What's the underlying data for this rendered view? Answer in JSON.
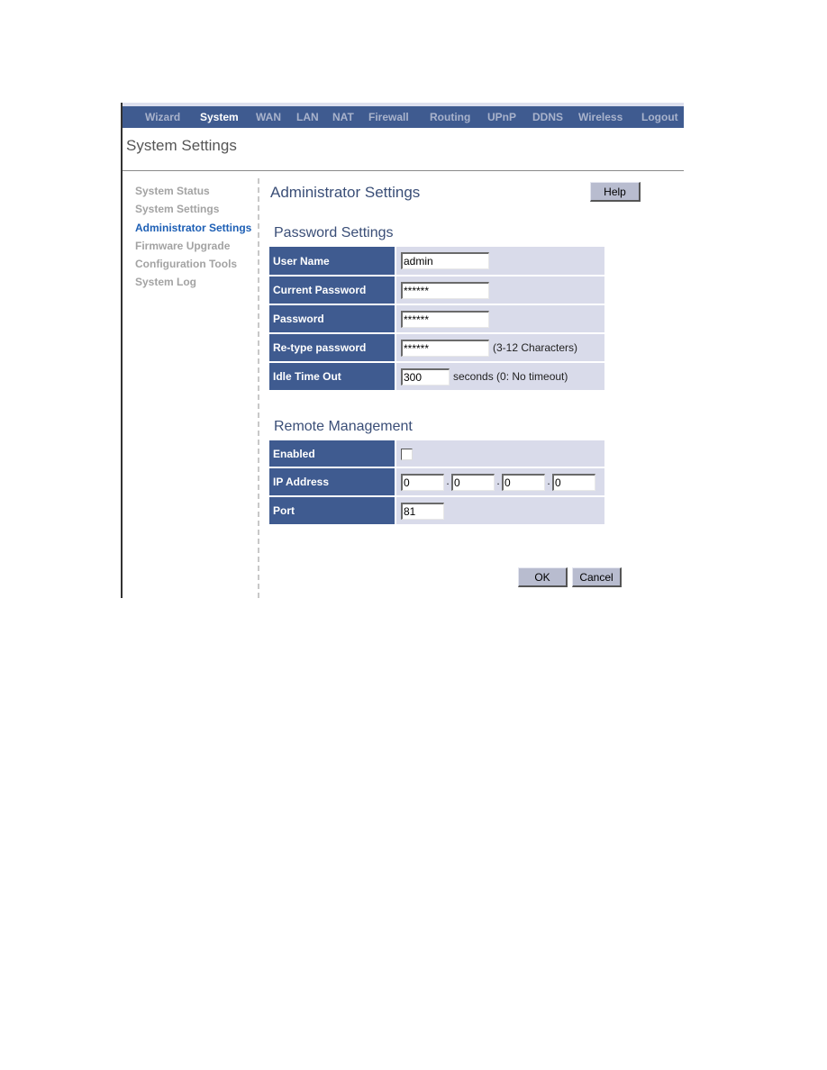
{
  "nav": {
    "items": [
      {
        "label": "Wizard",
        "active": false
      },
      {
        "label": "System",
        "active": true
      },
      {
        "label": "WAN",
        "active": false
      },
      {
        "label": "LAN",
        "active": false
      },
      {
        "label": "NAT",
        "active": false
      },
      {
        "label": "Firewall",
        "active": false
      },
      {
        "label": "Routing",
        "active": false
      },
      {
        "label": "UPnP",
        "active": false
      },
      {
        "label": "DDNS",
        "active": false
      },
      {
        "label": "Wireless",
        "active": false
      },
      {
        "label": "Logout",
        "active": false
      }
    ]
  },
  "page_title": "System Settings",
  "sidebar": {
    "items": [
      {
        "label": "System Status",
        "active": false
      },
      {
        "label": "System Settings",
        "active": false
      },
      {
        "label": "Administrator Settings",
        "active": true
      },
      {
        "label": "Firmware Upgrade",
        "active": false
      },
      {
        "label": "Configuration Tools",
        "active": false
      },
      {
        "label": "System Log",
        "active": false
      }
    ]
  },
  "content": {
    "title": "Administrator Settings",
    "help_label": "Help",
    "password_section": {
      "title": "Password Settings",
      "user_name": {
        "label": "User Name",
        "value": "admin"
      },
      "current_password": {
        "label": "Current Password",
        "value": "******"
      },
      "password": {
        "label": "Password",
        "value": "******"
      },
      "retype_password": {
        "label": "Re-type password",
        "value": "******",
        "note": "(3-12 Characters)"
      },
      "idle_timeout": {
        "label": "Idle Time Out",
        "value": "300",
        "note": "seconds (0: No timeout)"
      }
    },
    "remote_section": {
      "title": "Remote Management",
      "enabled": {
        "label": "Enabled",
        "checked": false
      },
      "ip_address": {
        "label": "IP Address",
        "octets": [
          "0",
          "0",
          "0",
          "0"
        ],
        "separator": "."
      },
      "port": {
        "label": "Port",
        "value": "81"
      }
    },
    "ok_label": "OK",
    "cancel_label": "Cancel"
  },
  "colors": {
    "nav_bg": "#3f5b90",
    "label_bg": "#3f5b90",
    "value_bg": "#d9dbea",
    "active_link": "#1d5fb5",
    "inactive_link": "#a3a3a3",
    "button_bg": "#b8bccf"
  }
}
